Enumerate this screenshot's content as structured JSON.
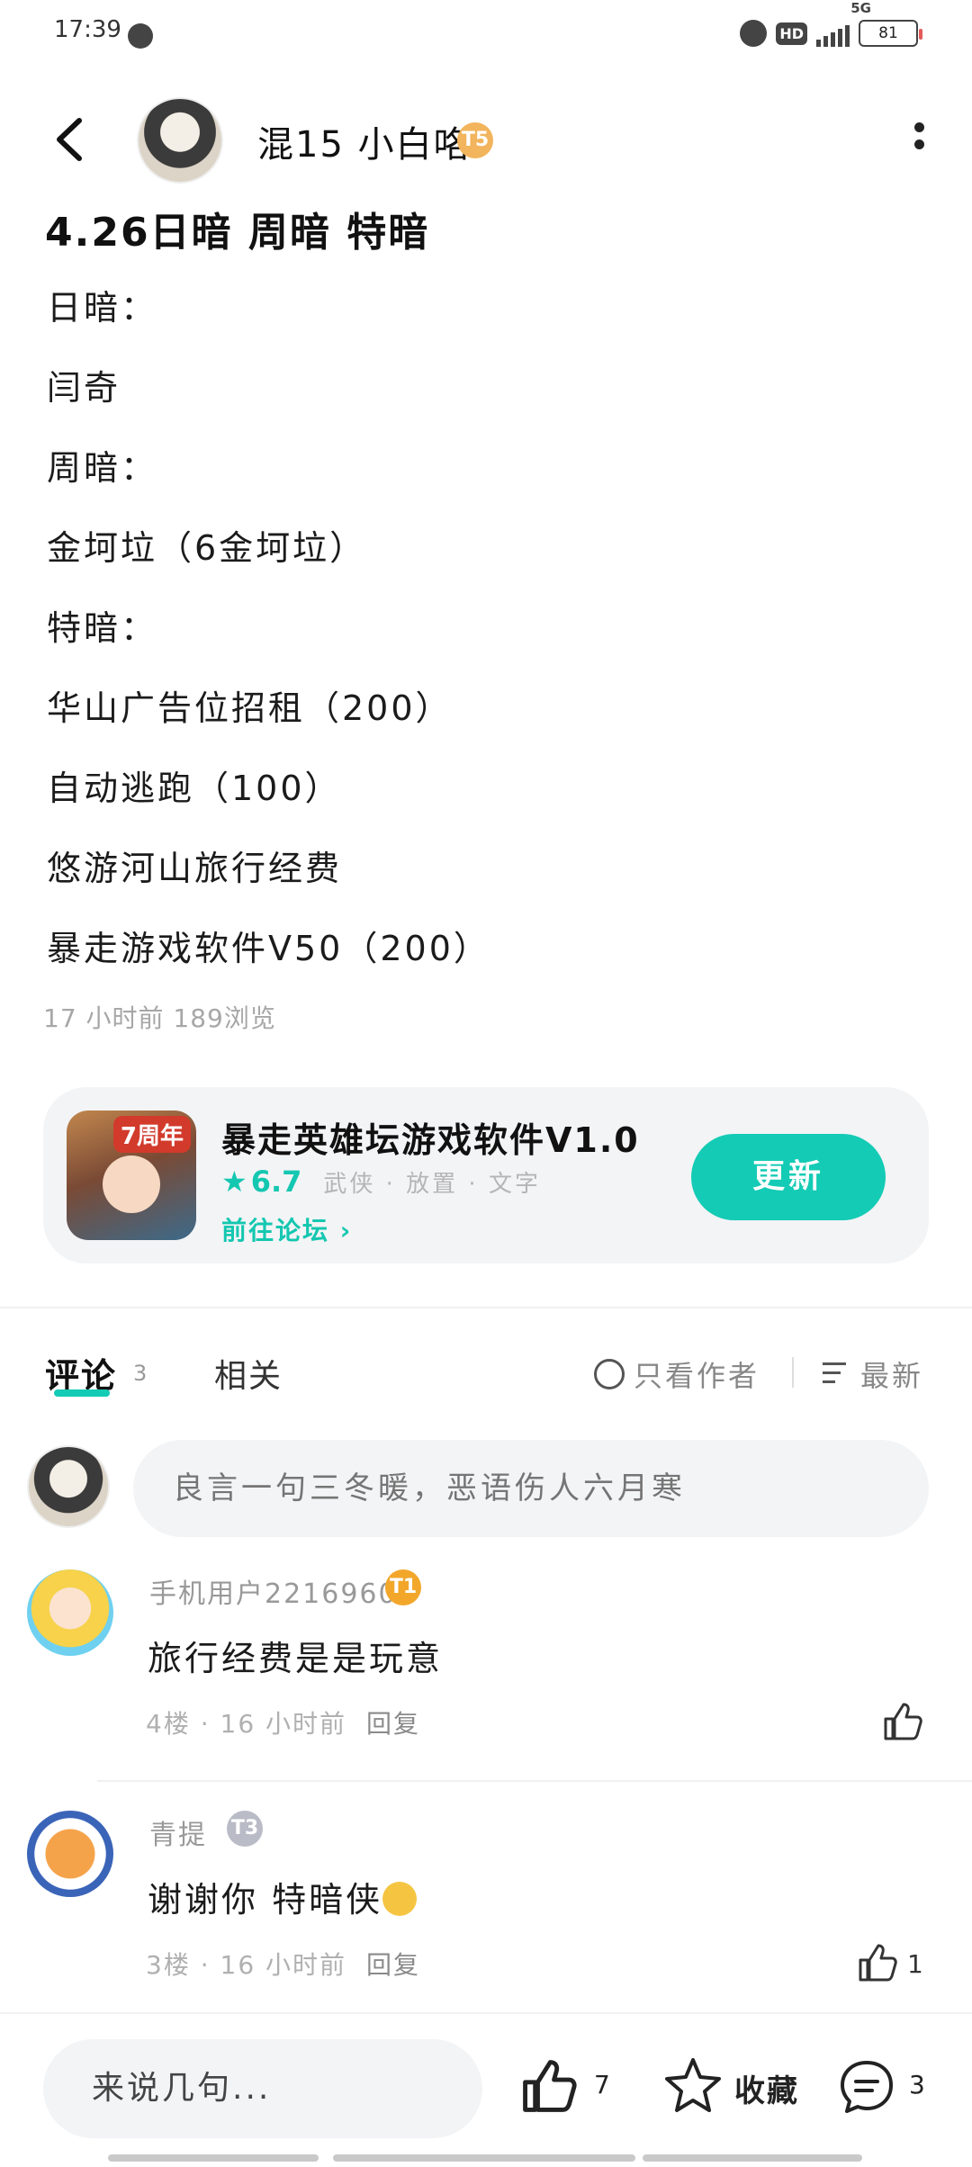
{
  "status_bar": {
    "time": "17:39",
    "network": "5G",
    "battery": "81"
  },
  "header": {
    "author_name": "混15 小白咯",
    "author_level": "T5"
  },
  "post": {
    "title": "4.26日暗 周暗 特暗",
    "lines": [
      "日暗：",
      "闫奇",
      "周暗：",
      "金坷垃（6金坷垃）",
      "特暗：",
      "华山广告位招租（200）",
      "自动逃跑（100）",
      "悠游河山旅行经费",
      "暴走游戏软件V50（200）"
    ],
    "meta": "17 小时前  189浏览"
  },
  "game_card": {
    "badge": "7周年",
    "title": "暴走英雄坛游戏软件V1.0",
    "rating": "6.7",
    "tags": "武侠 · 放置 · 文字",
    "forum_link": "前往论坛",
    "update_button": "更新"
  },
  "tabs": {
    "comments_label": "评论",
    "comments_count": "3",
    "related_label": "相关",
    "author_only_label": "只看作者",
    "sort_label": "最新"
  },
  "comment_box": {
    "placeholder": "良言一句三冬暖，恶语伤人六月寒"
  },
  "comments": [
    {
      "name": "手机用户22169608",
      "level": "T1",
      "text": "旅行经费是是玩意",
      "meta": "4楼 · 16 小时前",
      "reply": "回复",
      "likes": ""
    },
    {
      "name": "青提",
      "level": "T3",
      "text": "谢谢你 特暗侠",
      "meta": "3楼 · 16 小时前",
      "reply": "回复",
      "likes": "1"
    }
  ],
  "bottom_bar": {
    "input_placeholder": "来说几句...",
    "like_count": "7",
    "favorite_label": "收藏",
    "comment_count": "3"
  },
  "colors": {
    "accent": "#14cbb5",
    "card_bg": "#f3f4f6"
  }
}
